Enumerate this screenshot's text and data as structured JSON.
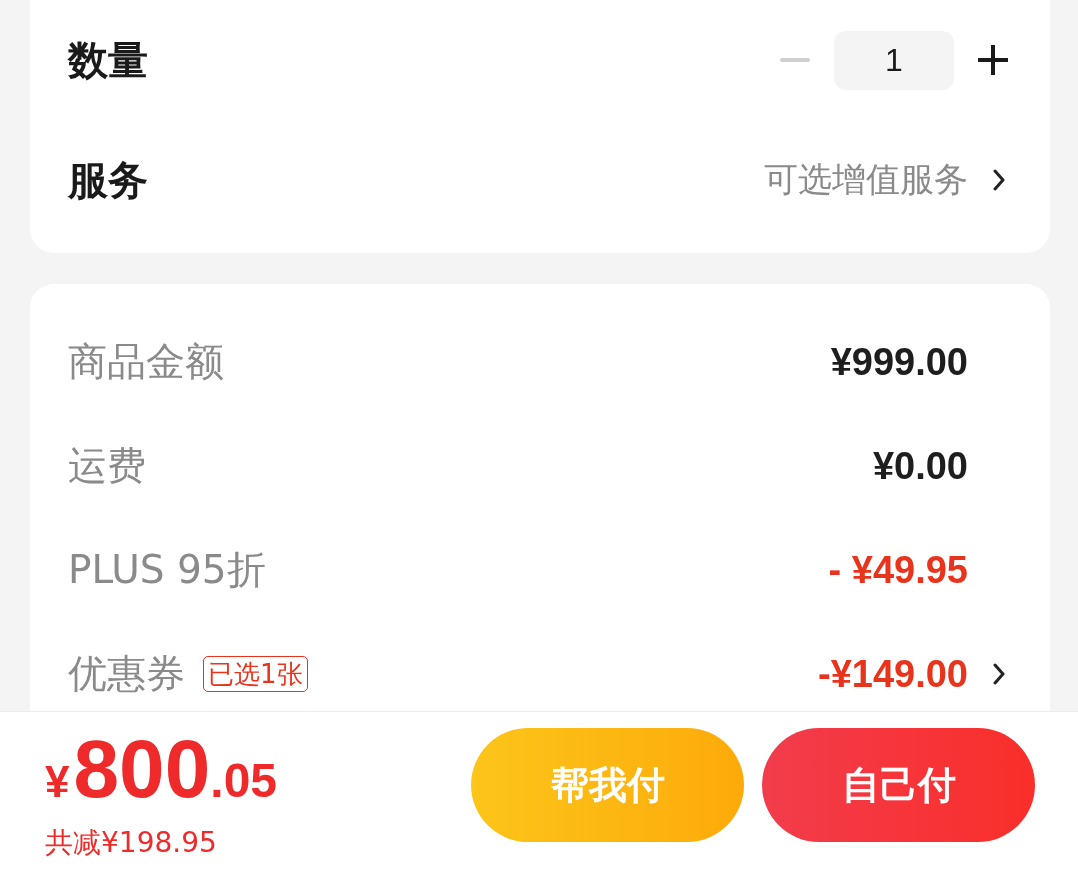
{
  "quantity": {
    "label": "数量",
    "value": "1",
    "decrease": {
      "disabled": true
    },
    "increase": {
      "disabled": false
    }
  },
  "service": {
    "label": "服务",
    "value": "可选增值服务"
  },
  "price_rows": [
    {
      "label": "商品金额",
      "value": "¥999.00",
      "discount": false,
      "chevron": false
    },
    {
      "label": "运费",
      "value": "¥0.00",
      "discount": false,
      "chevron": false
    },
    {
      "label": "PLUS 95折",
      "value": "- ¥49.95",
      "discount": true,
      "chevron": false
    },
    {
      "label": "优惠券",
      "badge": "已选1张",
      "value": "-¥149.00",
      "discount": true,
      "chevron": true
    }
  ],
  "footer": {
    "total": {
      "currency": "¥",
      "integer": "800",
      "decimal": ".05"
    },
    "savings": "共减¥198.95",
    "buttons": [
      {
        "label": "帮我付",
        "kind": "secondary"
      },
      {
        "label": "自己付",
        "kind": "primary"
      }
    ]
  }
}
